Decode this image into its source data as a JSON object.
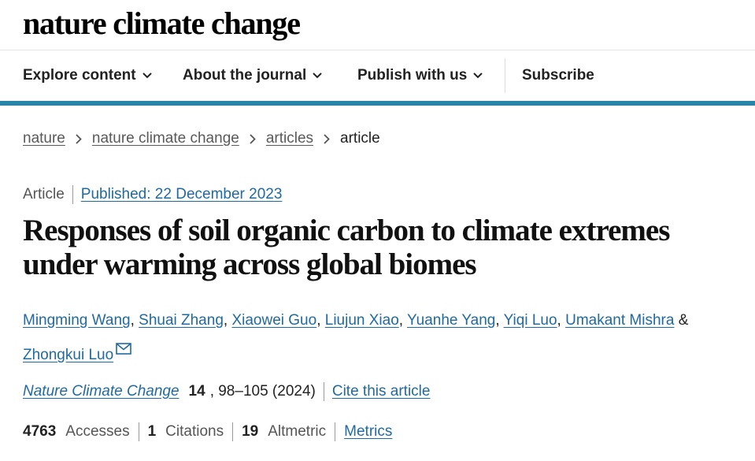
{
  "header": {
    "logo": "nature climate change"
  },
  "nav": {
    "items": [
      {
        "label": "Explore content",
        "has_dropdown": true
      },
      {
        "label": "About the journal",
        "has_dropdown": true
      },
      {
        "label": "Publish with us",
        "has_dropdown": true
      },
      {
        "label": "Subscribe",
        "has_dropdown": false
      }
    ],
    "accent_color": "#2a84a8"
  },
  "breadcrumb": {
    "items": [
      "nature",
      "nature climate change",
      "articles"
    ],
    "current": "article",
    "separator_icon": "chevron-right-icon"
  },
  "article": {
    "type": "Article",
    "published": "Published: 22 December 2023",
    "title": "Responses of soil organic carbon to climate extremes under warming across global biomes",
    "authors": [
      "Mingming Wang",
      "Shuai Zhang",
      "Xiaowei Guo",
      "Liujun Xiao",
      "Yuanhe Yang",
      "Yiqi Luo",
      "Umakant Mishra",
      "Zhongkui Luo"
    ],
    "author_joiner": ",",
    "author_last_joiner": "&",
    "corresponding_icon": "mail-icon",
    "journal": "Nature Climate Change",
    "volume": "14",
    "pages_year": ", 98–105 (2024)",
    "cite_label": "Cite this article"
  },
  "metrics": {
    "accesses_value": "4763",
    "accesses_label": "Accesses",
    "citations_value": "1",
    "citations_label": "Citations",
    "altmetric_value": "19",
    "altmetric_label": "Altmetric",
    "link_label": "Metrics"
  },
  "colors": {
    "link": "#1f6aa0",
    "text": "#222222",
    "muted": "#555555"
  }
}
